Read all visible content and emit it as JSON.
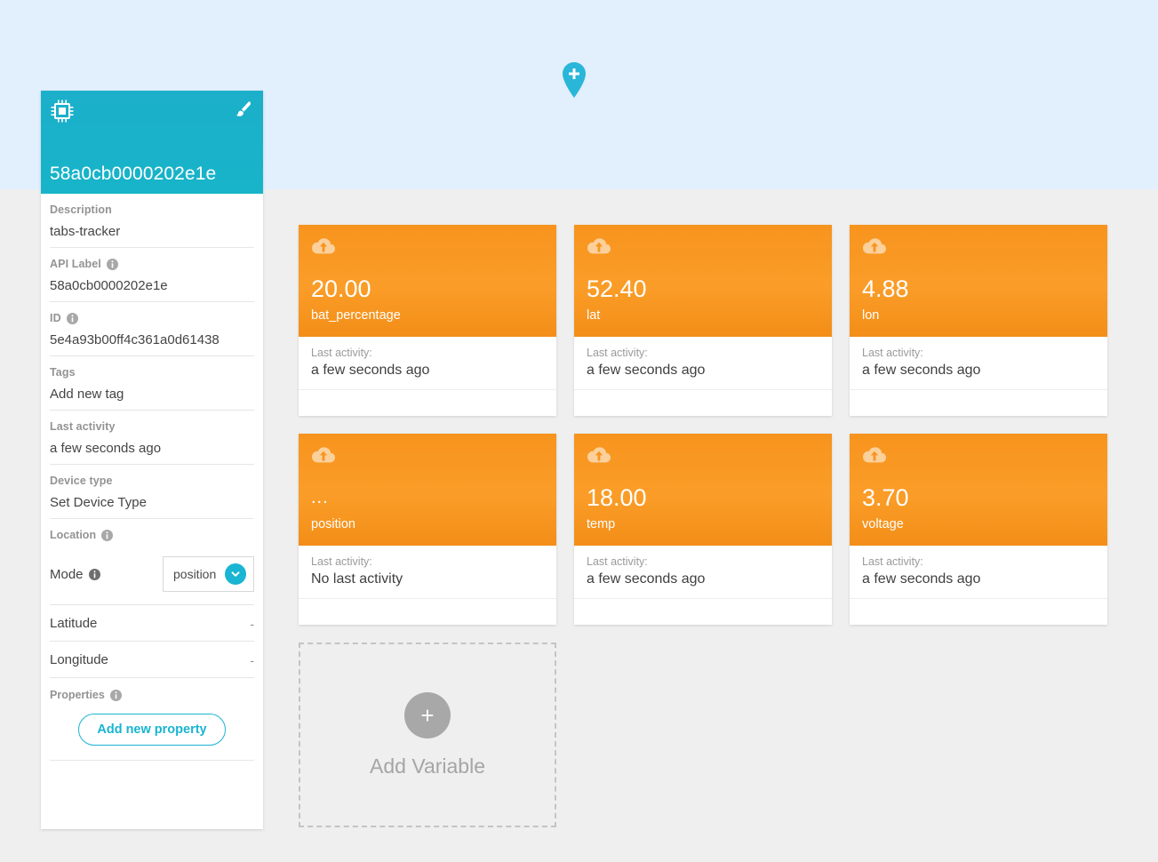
{
  "map": {
    "background_color": "#e2effd",
    "pin": {
      "icon": "map-pin-plus-icon",
      "color": "#29b6d8"
    }
  },
  "device_panel": {
    "header": {
      "title": "58a0cb0000202e1e",
      "chip_icon": "microchip-icon",
      "edit_icon": "paintbrush-icon",
      "accent_color": "#1bb0ca"
    },
    "fields": [
      {
        "label": "Description",
        "value": "tabs-tracker",
        "has_info": false
      },
      {
        "label": "API Label",
        "value": "58a0cb0000202e1e",
        "has_info": true
      },
      {
        "label": "ID",
        "value": "5e4a93b00ff4c361a0d61438",
        "has_info": true
      },
      {
        "label": "Tags",
        "value": "Add new tag",
        "has_info": false
      },
      {
        "label": "Last activity",
        "value": "a few seconds ago",
        "has_info": false
      },
      {
        "label": "Device type",
        "value": "Set Device Type",
        "has_info": false
      }
    ],
    "location": {
      "label": "Location",
      "mode_label": "Mode",
      "mode_value": "position",
      "chevron_icon": "chevron-down-icon",
      "latitude_label": "Latitude",
      "latitude_value": "-",
      "longitude_label": "Longitude",
      "longitude_value": "-"
    },
    "properties": {
      "label": "Properties",
      "add_button": "Add new property"
    },
    "info_icon": "info-icon"
  },
  "variables": {
    "activity_label": "Last activity:",
    "cloud_icon": "cloud-upload-icon",
    "cards": [
      {
        "value": "20.00",
        "name": "bat_percentage",
        "activity": "a few seconds ago"
      },
      {
        "value": "52.40",
        "name": "lat",
        "activity": "a few seconds ago"
      },
      {
        "value": "4.88",
        "name": "lon",
        "activity": "a few seconds ago"
      },
      {
        "value": "...",
        "name": "position",
        "activity": "No last activity"
      },
      {
        "value": "18.00",
        "name": "temp",
        "activity": "a few seconds ago"
      },
      {
        "value": "3.70",
        "name": "voltage",
        "activity": "a few seconds ago"
      }
    ],
    "add_variable": {
      "label": "Add Variable",
      "plus_icon": "plus-icon"
    }
  }
}
